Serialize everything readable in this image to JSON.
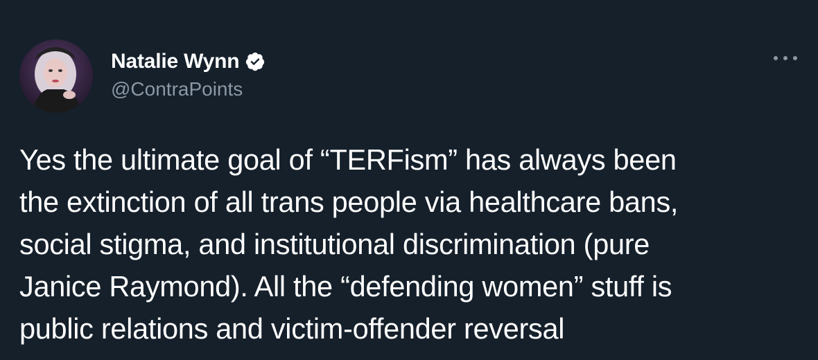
{
  "author": {
    "display_name": "Natalie Wynn",
    "handle": "@ContraPoints",
    "verified_icon": "verified-badge-icon",
    "avatar_icon": "profile-photo"
  },
  "menu": {
    "icon": "more-options-icon"
  },
  "tweet": {
    "lines": [
      "Yes the ultimate goal of “TERFism” has always been",
      "the extinction of all trans people via healthcare bans,",
      "social stigma, and institutional discrimination (pure",
      "Janice Raymond). All the “defending women” stuff is",
      "public relations and victim-offender reversal"
    ]
  },
  "colors": {
    "background": "#15202b",
    "primary_text": "#ffffff",
    "secondary_text": "#8b98a5"
  }
}
